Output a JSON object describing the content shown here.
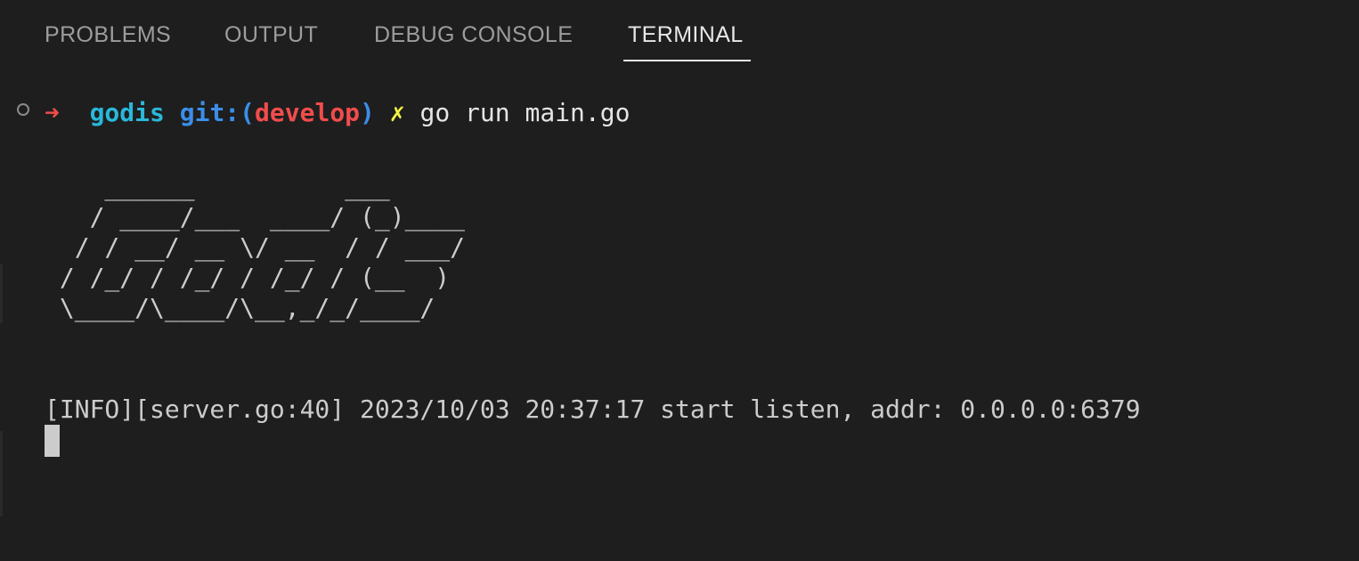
{
  "tabs": [
    {
      "label": "PROBLEMS"
    },
    {
      "label": "OUTPUT"
    },
    {
      "label": "DEBUG CONSOLE"
    },
    {
      "label": "TERMINAL"
    }
  ],
  "active_tab": "TERMINAL",
  "prompt": {
    "arrow": "➜",
    "directory": "godis",
    "git_label": "git:(",
    "branch": "develop",
    "git_close": ")",
    "dirty_marker": "✗",
    "command": "go run main.go"
  },
  "ascii_art": [
    "    ______          ___",
    "   / ____/___  ____/ (_)____",
    "  / / __/ __ \\/ __  / / ___/",
    " / /_/ / /_/ / /_/ / (__  )",
    " \\____/\\____/\\__,_/_/____/"
  ],
  "log": "[INFO][server.go:40] 2023/10/03 20:37:17 start listen, addr: 0.0.0.0:6379",
  "colors": {
    "background": "#1e1e1e",
    "arrow": "#f14c4c",
    "directory": "#29b8db",
    "git": "#3b8eea",
    "branch": "#f14c4c",
    "dirty": "#f5f543"
  },
  "icons": {
    "status": "circle-outline-icon",
    "cursor": "block-cursor"
  }
}
